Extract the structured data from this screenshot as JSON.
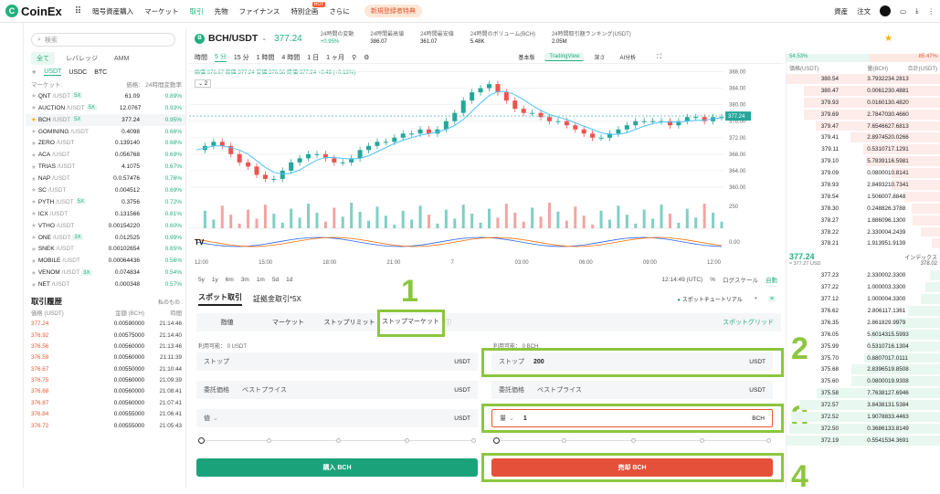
{
  "topbar": {
    "logo": "CoinEx",
    "nav": [
      "暗号資産購入",
      "マーケット",
      "取引",
      "先物",
      "ファイナンス",
      "特別企画",
      "さらに"
    ],
    "active_nav": "取引",
    "hot": "HOT",
    "promo": "新規登録者特典",
    "right": [
      "資産",
      "注文"
    ]
  },
  "markets": {
    "search_placeholder": "検索",
    "filter_tabs": [
      "全て",
      "レバレッジ",
      "AMM"
    ],
    "quote_tabs": [
      "USDT",
      "USDC",
      "BTC"
    ],
    "col_market": "マーケット:",
    "col_price": "価格:",
    "col_change": "24時間変動率",
    "rows": [
      {
        "name": "QNT",
        "quote": "/USDT",
        "lev": "5X",
        "price": "61.09",
        "change": "0.89%"
      },
      {
        "name": "AUCTION",
        "quote": "/USDT",
        "lev": "5X",
        "price": "12.0767",
        "change": "0.93%"
      },
      {
        "name": "BCH",
        "quote": "/USDT",
        "lev": "5X",
        "price": "377.24",
        "change": "0.95%"
      },
      {
        "name": "GOMINING",
        "quote": "/USDT",
        "lev": "",
        "price": "0.4098",
        "change": "0.66%"
      },
      {
        "name": "ZERO",
        "quote": "/USDT",
        "lev": "",
        "price": "0.139140",
        "change": "0.68%"
      },
      {
        "name": "ACA",
        "quote": "/USDT",
        "lev": "",
        "price": "0.056768",
        "change": "0.69%"
      },
      {
        "name": "TRIAS",
        "quote": "/USDT",
        "lev": "",
        "price": "4.1075",
        "change": "0.67%"
      },
      {
        "name": "NAP",
        "quote": "/USDT",
        "lev": "",
        "price": "0.0.57476",
        "change": "0.76%"
      },
      {
        "name": "SC",
        "quote": "/USDT",
        "lev": "",
        "price": "0.004512",
        "change": "0.69%"
      },
      {
        "name": "PYTH",
        "quote": "/USDT",
        "lev": "5X",
        "price": "0.3756",
        "change": "0.72%"
      },
      {
        "name": "ICX",
        "quote": "/USDT",
        "lev": "",
        "price": "0.131566",
        "change": "0.81%"
      },
      {
        "name": "VTHO",
        "quote": "/USDT",
        "lev": "",
        "price": "0.00154220",
        "change": "0.60%"
      },
      {
        "name": "ONE",
        "quote": "/USDT",
        "lev": "3X",
        "price": "0.012525",
        "change": "0.99%"
      },
      {
        "name": "SNEK",
        "quote": "/USDT",
        "lev": "",
        "price": "0.00102654",
        "change": "0.65%"
      },
      {
        "name": "MOBILE",
        "quote": "/USDT",
        "lev": "",
        "price": "0.00064436",
        "change": "0.56%"
      },
      {
        "name": "VENOM",
        "quote": "/USDT",
        "lev": "3X",
        "price": "0.074834",
        "change": "0.54%"
      },
      {
        "name": "NET",
        "quote": "/USDT",
        "lev": "",
        "price": "0.000348",
        "change": "0.57%"
      }
    ]
  },
  "history": {
    "title": "取引履歴",
    "mine": "私のもの",
    "col_price": "価格 (USDT)",
    "col_amount": "金額 (BCH)",
    "col_time": "時間",
    "rows": [
      [
        "377.24",
        "0.00590000",
        "21:14:46"
      ],
      [
        "376.92",
        "0.00575000",
        "21:14:40"
      ],
      [
        "376.56",
        "0.00560000",
        "21:13:46"
      ],
      [
        "376.59",
        "0.00560000",
        "21:11:39"
      ],
      [
        "376.67",
        "0.00550000",
        "21:10:44"
      ],
      [
        "376.75",
        "0.00560000",
        "21:09:39"
      ],
      [
        "376.68",
        "0.00560000",
        "21:08:41"
      ],
      [
        "376.87",
        "0.00560000",
        "21:07:41"
      ],
      [
        "376.84",
        "0.00555000",
        "21:06:41"
      ],
      [
        "376.72",
        "0.00555000",
        "21:05:43"
      ]
    ]
  },
  "header": {
    "symbol": "BCH/USDT",
    "last_price": "377.24",
    "stats": [
      {
        "label": "24時間の変動",
        "value": "+0.95%",
        "green": true
      },
      {
        "label": "24時間最高値",
        "value": "386.07",
        "green": false
      },
      {
        "label": "24時間最安値",
        "value": "361.07",
        "green": false
      },
      {
        "label": "24時間のボリューム(BCH)",
        "value": "5.48K",
        "green": false
      },
      {
        "label": "24時間取引額ランキング(USDT)",
        "value": "2.05M",
        "green": false
      }
    ]
  },
  "chart_toolbar": {
    "intervals": [
      "時間",
      "5 分",
      "15 分",
      "1 時間",
      "4 時間",
      "1 日",
      "1 ヶ月"
    ],
    "active_interval": "5 分",
    "views": [
      "基本版",
      "TradingView",
      "深さ",
      "AI分析"
    ],
    "active_view": "TradingView",
    "ohlc_line": "始値 376.67 高値 377.24 安値 376.56 終値 377.24 +0.49 (+0.13%)",
    "indicator_toggle": "2"
  },
  "chart_data": {
    "type": "line",
    "title": "",
    "x_tick_labels": [
      "12:00",
      "15:00",
      "18:00",
      "21:00",
      "7",
      "03:00",
      "06:00",
      "09:00",
      "12:00"
    ],
    "y_tick_labels": [
      "388.00",
      "384.00",
      "380.00",
      "376.00",
      "372.00",
      "368.00",
      "364.00",
      "360.00"
    ],
    "ylim": [
      358,
      389
    ],
    "last_label": "377.24",
    "volume_tick": "250",
    "osc_tick": "0.00",
    "series": [
      {
        "values": [
          369,
          370,
          371,
          370,
          368,
          366,
          365,
          363,
          362,
          362,
          364,
          366,
          367,
          368,
          368,
          367,
          366,
          366,
          367,
          369,
          370,
          371,
          371,
          372,
          373,
          373,
          374,
          373,
          374,
          376,
          378,
          381,
          383,
          384,
          385,
          383,
          381,
          379,
          378,
          378,
          377,
          376,
          376,
          375,
          374,
          373,
          372,
          372,
          373,
          374,
          375,
          376,
          376,
          376,
          376,
          375,
          376,
          377,
          377,
          376,
          377,
          377
        ]
      }
    ]
  },
  "chart_footer": {
    "ranges": [
      "5y",
      "1y",
      "6m",
      "3m",
      "1m",
      "5d",
      "1d"
    ],
    "clock": "12:14:49 (UTC)",
    "pct": "%",
    "log": "ログスケール",
    "auto": "自動"
  },
  "order": {
    "tabs": [
      "スポット取引",
      "証拠金取引*5X"
    ],
    "tutorial": "スポットチュートリアル",
    "types": [
      "指値",
      "マーケット",
      "ストップリミット",
      "ストップマーケット"
    ],
    "active_type": "ストップマーケット",
    "grid": "スポットグリッド",
    "buy": {
      "available": "利用可能： 0 USDT",
      "stop_label": "ストップ",
      "stop_value": "",
      "stop_unit": "USDT",
      "price_label": "委託価格",
      "price_value": "ベストプライス",
      "price_unit": "USDT",
      "qty_label": "値",
      "qty_value": "",
      "qty_unit": "USDT",
      "button": "購入 BCH"
    },
    "sell": {
      "available": "利用可能： 0 BCH",
      "stop_label": "ストップ",
      "stop_value": "200",
      "stop_unit": "USDT",
      "price_label": "委託価格",
      "price_value": "ベストプライス",
      "price_unit": "USDT",
      "qty_label": "量",
      "qty_value": "1",
      "qty_unit": "BCH",
      "button": "売却 BCH"
    }
  },
  "steps": [
    "1",
    "2",
    "3",
    "4"
  ],
  "book": {
    "buy_ratio": "54.53%",
    "sell_ratio": "85.47%",
    "col_price": "価格(USDT)",
    "col_amount": "量(BCH)",
    "col_total": "合計(USDT)",
    "asks": [
      [
        "380.54",
        "3.79322",
        "34.2813"
      ],
      [
        "380.47",
        "0.00612",
        "30.4881"
      ],
      [
        "379.93",
        "0.01601",
        "30.4820"
      ],
      [
        "379.69",
        "2.78470",
        "30.4660"
      ],
      [
        "379.47",
        "7.65466",
        "27.6813"
      ],
      [
        "379.41",
        "2.89745",
        "20.0266"
      ],
      [
        "379.11",
        "0.53107",
        "17.1291"
      ],
      [
        "379.10",
        "5.78391",
        "16.5981"
      ],
      [
        "379.09",
        "0.08000",
        "10.8141"
      ],
      [
        "378.93",
        "2.84932",
        "10.7341"
      ],
      [
        "378.54",
        "1.50600",
        "7.8848"
      ],
      [
        "378.30",
        "0.24882",
        "6.3788"
      ],
      [
        "378.27",
        "1.88609",
        "6.1300"
      ],
      [
        "378.22",
        "2.33000",
        "4.2439"
      ],
      [
        "378.21",
        "1.91395",
        "1.9139"
      ]
    ],
    "mid_price": "377.24",
    "mid_sub": "≈ 377.27 USD",
    "index_label": "インデックス",
    "index_value": "378.02",
    "bids": [
      [
        "377.23",
        "2.33000",
        "2.3300"
      ],
      [
        "377.22",
        "1.00000",
        "3.3300"
      ],
      [
        "377.12",
        "1.00000",
        "4.3300"
      ],
      [
        "376.62",
        "2.80611",
        "7.1361"
      ],
      [
        "376.35",
        "2.86182",
        "9.9979"
      ],
      [
        "376.05",
        "5.60143",
        "15.5993"
      ],
      [
        "375.99",
        "0.53107",
        "16.1304"
      ],
      [
        "375.70",
        "0.88070",
        "17.0111"
      ],
      [
        "375.68",
        "2.83965",
        "19.8508"
      ],
      [
        "375.60",
        "0.08000",
        "19.9308"
      ],
      [
        "375.58",
        "7.76381",
        "27.6946"
      ],
      [
        "372.57",
        "3.84381",
        "31.5384"
      ],
      [
        "372.52",
        "1.90788",
        "33.4463"
      ],
      [
        "372.50",
        "0.36861",
        "33.8149"
      ],
      [
        "372.19",
        "0.55415",
        "34.3691"
      ]
    ]
  }
}
